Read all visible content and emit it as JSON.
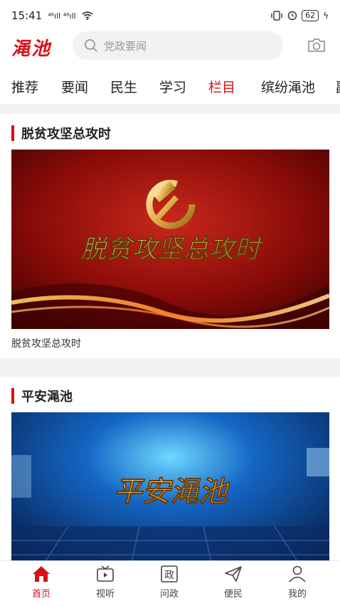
{
  "status": {
    "time": "15:41",
    "signal": "⁴⁶ıll ⁴⁶ıll",
    "battery": "62"
  },
  "header": {
    "logo": "渑池",
    "search_placeholder": "党政要闻"
  },
  "tabs": [
    {
      "label": "推荐"
    },
    {
      "label": "要闻"
    },
    {
      "label": "民生"
    },
    {
      "label": "学习"
    },
    {
      "label": "栏目"
    },
    {
      "label": "缤纷渑池"
    },
    {
      "label": "副"
    }
  ],
  "active_tab": "栏目",
  "sections": [
    {
      "title": "脱贫攻坚总攻时",
      "banner_text": "脱贫攻坚总攻时",
      "caption": "脱贫攻坚总攻时"
    },
    {
      "title": "平安渑池",
      "banner_text": "平安渑池"
    }
  ],
  "bottom_nav": [
    {
      "label": "首页"
    },
    {
      "label": "视听"
    },
    {
      "label": "问政"
    },
    {
      "label": "便民"
    },
    {
      "label": "我的"
    }
  ],
  "colors": {
    "accent": "#d90f19"
  }
}
